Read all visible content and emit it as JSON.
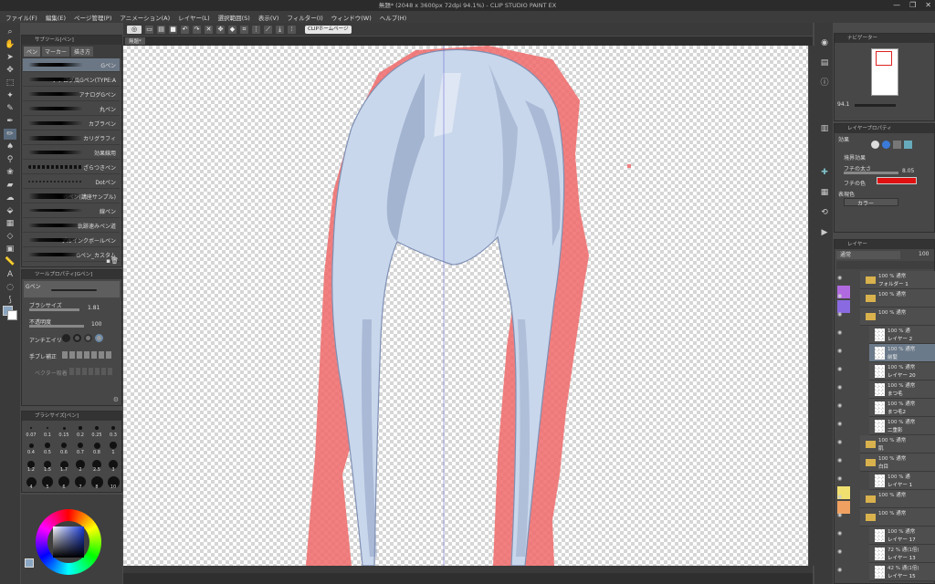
{
  "window": {
    "title": "無題* (2048 x 3600px 72dpi 94.1%) - CLIP STUDIO PAINT EX",
    "controls": [
      "—",
      "❐",
      "✕"
    ]
  },
  "menu": [
    "ファイル(F)",
    "編集(E)",
    "ページ管理(P)",
    "アニメーション(A)",
    "レイヤー(L)",
    "選択範囲(S)",
    "表示(V)",
    "フィルター(I)",
    "ウィンドウ(W)",
    "ヘルプ(H)"
  ],
  "toolbar": {
    "home_label": "CLIPホームページ"
  },
  "canvas_tab": "無題*",
  "subtool": {
    "header": "サブツール[ペン]",
    "tabs": [
      "ペン",
      "マーカー",
      "描き方"
    ],
    "brushes": [
      "Gペン",
      "アナログ風Gペン(TYPE:A",
      "アナログGペン",
      "丸ペン",
      "カブラペン",
      "カリグラフィ",
      "効果線用",
      "ざらつきペン",
      "Dotペン",
      "Gペン(講座サンプル)",
      "線ペン",
      "軌跡速みペン道",
      "ゲルインクボールペン",
      "Gペン_カスタム"
    ]
  },
  "tool_property": {
    "header": "ツールプロパティ[Gペン]",
    "tool_name": "Gペン",
    "brush_size_label": "ブラシサイズ",
    "brush_size": "1.81",
    "opacity_label": "不透明度",
    "opacity": "100",
    "antialias_label": "アンチエイリ",
    "stabilization_label": "手ブレ補正",
    "vector_label": "ベクター吸着"
  },
  "brush_size_panel": {
    "header": "ブラシサイズ[ペン]",
    "sizes": [
      "0.07",
      "0.1",
      "0.15",
      "0.2",
      "0.25",
      "0.3",
      "0.4",
      "0.5",
      "0.6",
      "0.7",
      "0.8",
      "1",
      "1.2",
      "1.5",
      "1.7",
      "2",
      "2.5",
      "3",
      "4",
      "5",
      "6",
      "7",
      "8",
      "10"
    ]
  },
  "navigator": {
    "header": "ナビゲーター",
    "zoom": "94.1"
  },
  "layer_property": {
    "header": "レイヤープロパティ",
    "effect_label": "効果",
    "border_effect_label": "境界効果",
    "edge_width_label": "フチの太さ",
    "edge_width": "8.05",
    "edge_color_label": "フチの色",
    "edge_color": "#e01010",
    "expression_color_label": "表現色",
    "expression_color": "カラー"
  },
  "layers": {
    "header": "レイヤー",
    "blend_mode": "通常",
    "opacity": "100",
    "items": [
      {
        "t1": "100 % 通常",
        "t2": "フォルダー 1",
        "type": "folder"
      },
      {
        "t1": "100 % 通常",
        "t2": "",
        "type": "folder"
      },
      {
        "t1": "100 % 通常",
        "t2": "",
        "type": "folder"
      },
      {
        "t1": "100 % 通",
        "t2": "レイヤー 2",
        "type": "layer"
      },
      {
        "t1": "100 % 通常",
        "t2": "前髪",
        "type": "layer",
        "selected": true
      },
      {
        "t1": "100 % 通常",
        "t2": "レイヤー 20",
        "type": "layer"
      },
      {
        "t1": "100 % 通常",
        "t2": "まつ毛",
        "type": "layer"
      },
      {
        "t1": "100 % 通常",
        "t2": "まつ毛2",
        "type": "layer"
      },
      {
        "t1": "100 % 通常",
        "t2": "二重影",
        "type": "layer"
      },
      {
        "t1": "100 % 通常",
        "t2": "肌",
        "type": "folder"
      },
      {
        "t1": "100 % 通常",
        "t2": "白目",
        "type": "folder"
      },
      {
        "t1": "100 % 通",
        "t2": "レイヤー 1",
        "type": "layer"
      },
      {
        "t1": "100 % 通常",
        "t2": "",
        "type": "folder"
      },
      {
        "t1": "100 % 通常",
        "t2": "",
        "type": "folder"
      },
      {
        "t1": "100 % 通常",
        "t2": "レイヤー 17",
        "type": "layer"
      },
      {
        "t1": "72 % 通(1倍)",
        "t2": "レイヤー 13",
        "type": "layer"
      },
      {
        "t1": "42 % 通(1倍)",
        "t2": "レイヤー 15",
        "type": "layer"
      }
    ]
  },
  "colors": {
    "hair": "#c9d7ec",
    "hair_shadow": "#8a9cbf",
    "outline_red": "#f06a6a",
    "selection_blue": "#6b7a8a"
  }
}
